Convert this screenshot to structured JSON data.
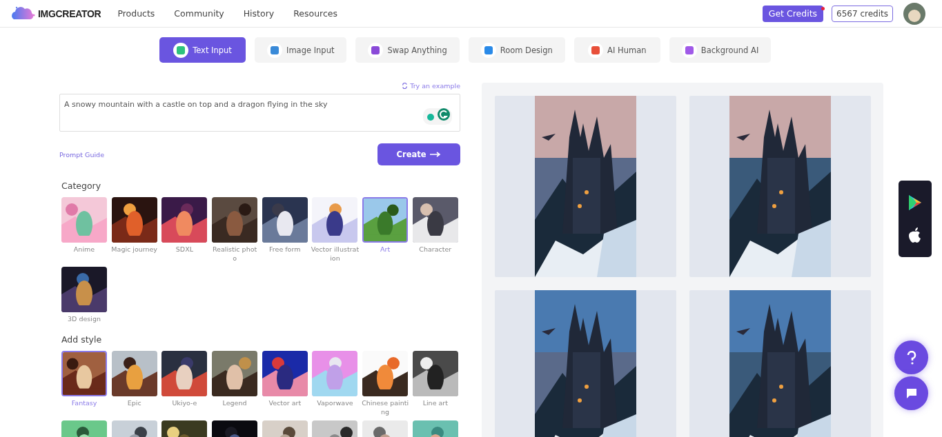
{
  "header": {
    "brand": "IMGCREATOR",
    "nav": [
      "Products",
      "Community",
      "History",
      "Resources"
    ],
    "get_credits": "Get Credits",
    "notification": true,
    "credits": "6567 credits"
  },
  "tabs": [
    {
      "label": "Text Input",
      "selected": true
    },
    {
      "label": "Image Input",
      "selected": false
    },
    {
      "label": "Swap Anything",
      "selected": false
    },
    {
      "label": "Room Design",
      "selected": false
    },
    {
      "label": "AI Human",
      "selected": false
    },
    {
      "label": "Background AI",
      "selected": false
    }
  ],
  "prompt": {
    "try_example": "Try an example",
    "value": "A snowy mountain with a castle on top and a dragon flying in the sky",
    "guide": "Prompt Guide",
    "create": "Create"
  },
  "category": {
    "title": "Category",
    "items": [
      {
        "label": "Anime",
        "selected": false
      },
      {
        "label": "Magic journey",
        "selected": false
      },
      {
        "label": "SDXL",
        "selected": false
      },
      {
        "label": "Realistic photo",
        "selected": false
      },
      {
        "label": "Free form",
        "selected": false
      },
      {
        "label": "Vector illustration",
        "selected": false
      },
      {
        "label": "Art",
        "selected": true
      },
      {
        "label": "Character",
        "selected": false
      },
      {
        "label": "3D design",
        "selected": false
      }
    ]
  },
  "style": {
    "title": "Add style",
    "items": [
      {
        "label": "Fantasy",
        "selected": true
      },
      {
        "label": "Epic",
        "selected": false
      },
      {
        "label": "Ukiyo-e",
        "selected": false
      },
      {
        "label": "Legend",
        "selected": false
      },
      {
        "label": "Vector art",
        "selected": false
      },
      {
        "label": "Vaporwave",
        "selected": false
      },
      {
        "label": "Chinese painting",
        "selected": false
      },
      {
        "label": "Line art",
        "selected": false
      },
      {
        "selected": false
      },
      {
        "selected": false
      },
      {
        "selected": false
      },
      {
        "selected": false
      },
      {
        "selected": false
      },
      {
        "selected": false
      },
      {
        "selected": false
      },
      {
        "selected": false
      }
    ]
  }
}
